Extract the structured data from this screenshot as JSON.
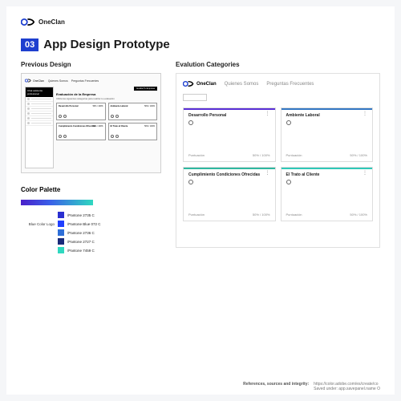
{
  "brand": {
    "name": "OneClan"
  },
  "section": {
    "number": "03",
    "title": "App Design Prototype"
  },
  "previous": {
    "heading": "Previous Design",
    "nav": [
      "Quienes Somos",
      "Preguntas Frecuentes"
    ],
    "sidebar_title": "Chat asistente profesional",
    "main_title": "Evaluación de la Empresa",
    "main_sub": "Utiliza las siguientes categorías para realizar tu evaluación",
    "cta": "Evalúa Tu Empresa",
    "score": "50% / 100%"
  },
  "evaluation": {
    "heading": "Evalution Categories",
    "nav": [
      "Quienes Somos",
      "Preguntas Frecuentes"
    ],
    "cards": [
      {
        "title": "Desarrollo Personal",
        "metric": "Puntuación",
        "score": "50% / 100%"
      },
      {
        "title": "Ambiente Laboral",
        "metric": "Puntuación",
        "score": "50% / 100%"
      },
      {
        "title": "Cumplimiento Condiciones Ofrecidas",
        "metric": "Puntuación",
        "score": "50% / 100%"
      },
      {
        "title": "El Trato al Cliente",
        "metric": "Puntuación",
        "score": "50% / 100%"
      }
    ]
  },
  "palette": {
    "heading": "Color Palette",
    "group_label": "Blue Color Logo",
    "swatches": [
      {
        "hex": "#2a2fd0",
        "name": "/Pantone 2735 C"
      },
      {
        "hex": "#1f3fff",
        "name": "/Pantone Blue 072 C"
      },
      {
        "hex": "#2f6fd8",
        "name": "/Pantone 2736 C"
      },
      {
        "hex": "#1a2a7a",
        "name": "/Pantone 2727 C"
      },
      {
        "hex": "#2fd8c0",
        "name": "/Pantone 7459 C"
      }
    ]
  },
  "footer": {
    "label": "References, sources and integrity:",
    "line1": "https://color.adobe.com/es/create/co",
    "line2": "Saved under: app.savepanel.name O"
  }
}
